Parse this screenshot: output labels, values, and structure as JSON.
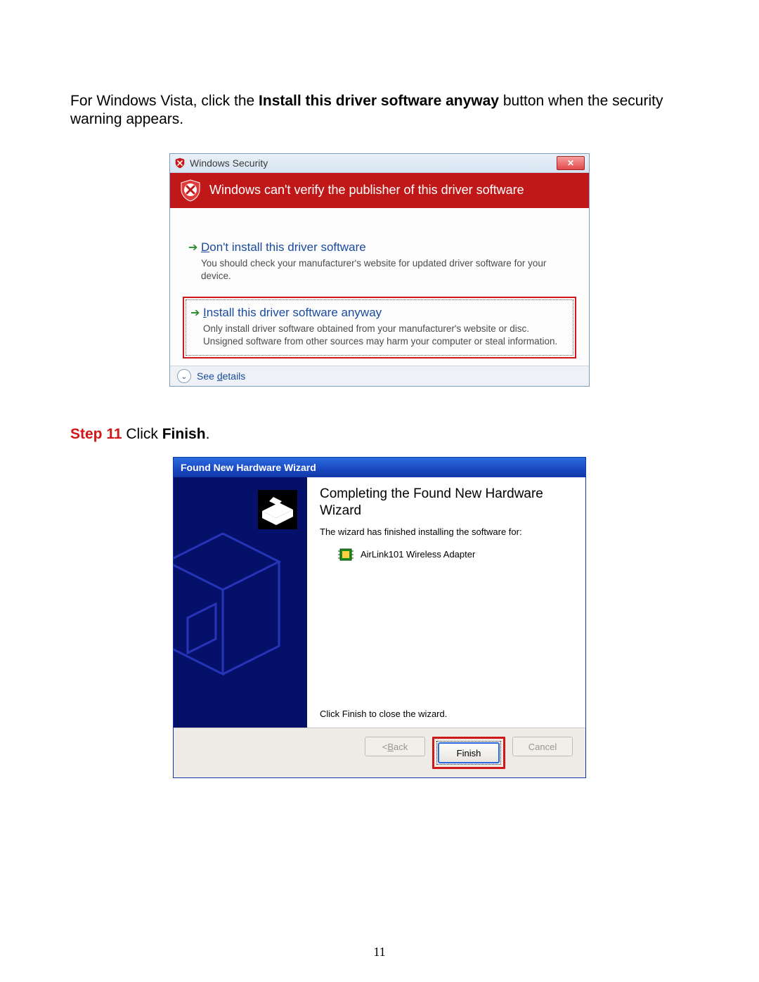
{
  "intro": {
    "pre": "For Windows Vista, click the ",
    "bold": "Install this driver software anyway",
    "post": " button when the security warning appears."
  },
  "vista": {
    "title": "Windows Security",
    "close_label": "✕",
    "banner": "Windows can't verify the publisher of this driver software",
    "option1": {
      "title_pre": "",
      "title_ul": "D",
      "title_post": "on't install this driver software",
      "desc": "You should check your manufacturer's website for updated driver software for your device."
    },
    "option2": {
      "title_ul": "I",
      "title_post": "nstall this driver software anyway",
      "desc": "Only install driver software obtained from your manufacturer's website or disc. Unsigned software from other sources may harm your computer or steal information."
    },
    "details_pre": "See ",
    "details_ul": "d",
    "details_post": "etails"
  },
  "step11": {
    "label": "Step 11",
    "text_pre": " Click ",
    "text_bold": "Finish",
    "text_post": "."
  },
  "xp": {
    "title": "Found New Hardware Wizard",
    "heading": "Completing the Found New Hardware Wizard",
    "sub": "The wizard has finished installing the software for:",
    "device": "AirLink101 Wireless Adapter",
    "closehint": "Click Finish to close the wizard.",
    "back_pre": "< ",
    "back_ul": "B",
    "back_post": "ack",
    "finish": "Finish",
    "cancel": "Cancel"
  },
  "page_number": "11"
}
